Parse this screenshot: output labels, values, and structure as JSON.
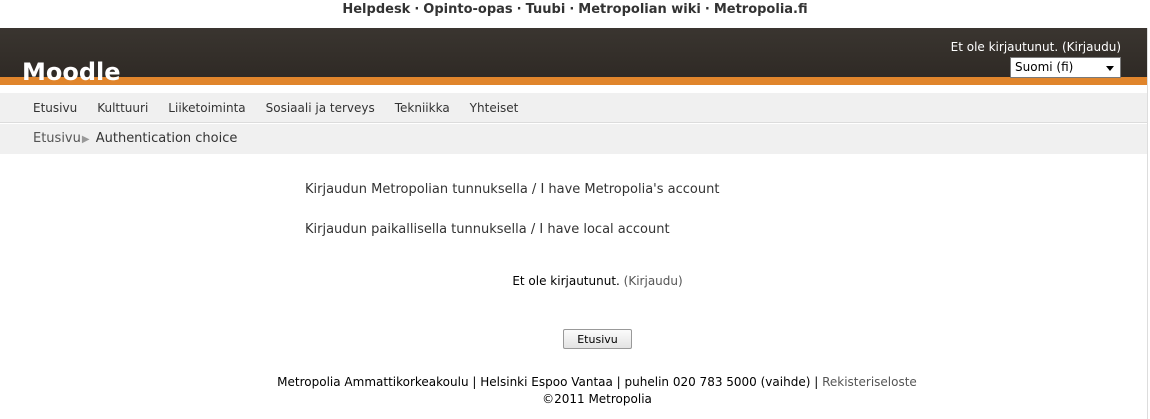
{
  "top_links": [
    "Helpdesk",
    "Opinto-opas",
    "Tuubi",
    "Metropolian wiki",
    "Metropolia.fi"
  ],
  "top_links_separator": "·",
  "header": {
    "logo": "Moodle",
    "login_text": "Et ole kirjautunut.",
    "login_link": "(Kirjaudu)",
    "language_selected": "Suomi (fi)"
  },
  "menu": [
    "Etusivu",
    "Kulttuuri",
    "Liiketoiminta",
    "Sosiaali ja terveys",
    "Tekniikka",
    "Yhteiset"
  ],
  "breadcrumb": {
    "home": "Etusivu",
    "separator": "▶",
    "current": "Authentication choice"
  },
  "auth_options": [
    "Kirjaudun Metropolian tunnuksella / I have Metropolia's account",
    "Kirjaudun paikallisella tunnuksella / I have local account"
  ],
  "not_logged_in": {
    "text": "Et ole kirjautunut.",
    "link": "(Kirjaudu)"
  },
  "home_button": "Etusivu",
  "footer": {
    "line1": "Metropolia Ammattikorkeakoulu | Helsinki Espoo Vantaa | puhelin 020 783 5000 (vaihde) |",
    "link": "Rekisteriseloste",
    "copyright": "©2011 Metropolia"
  }
}
